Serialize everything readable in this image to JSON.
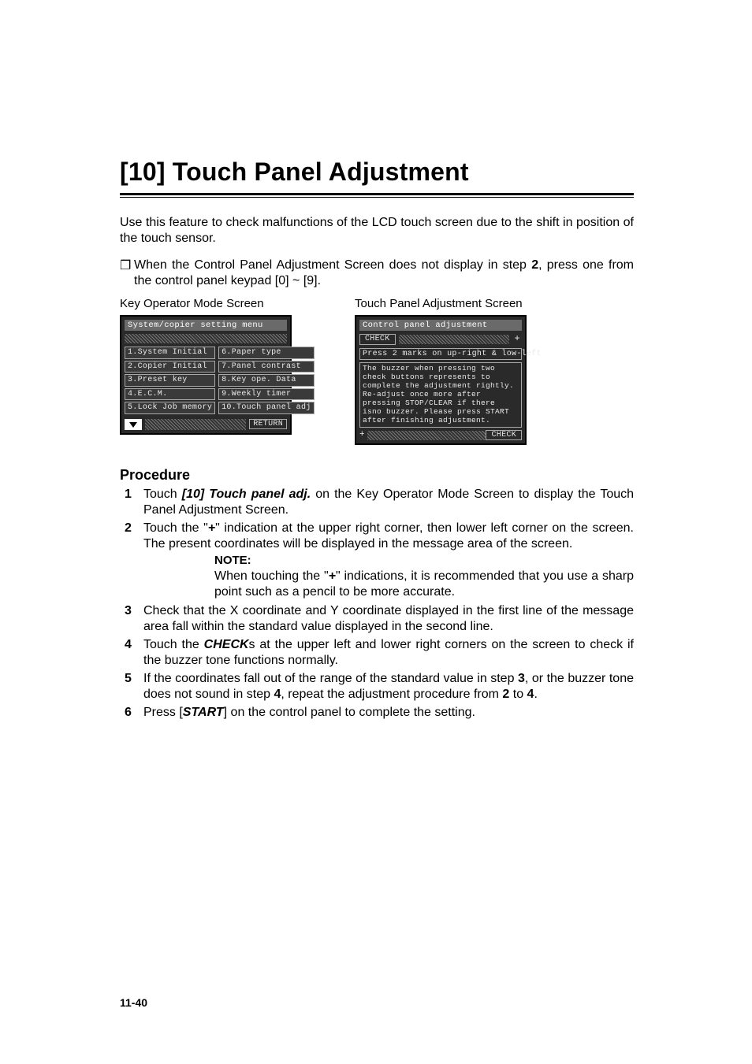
{
  "title": "[10] Touch Panel Adjustment",
  "intro": "Use this feature to check malfunctions of the LCD touch screen due to the shift in position of the touch sensor.",
  "bullet_symbol": "❐",
  "bullet_pre": "When the Control Panel Adjustment Screen does not display in step ",
  "bullet_bold": "2",
  "bullet_post": ", press one from the control panel keypad [0] ~ [9].",
  "screen1": {
    "caption": "Key Operator Mode Screen",
    "header": "System/copier setting menu",
    "left": [
      "1.System Initial",
      "2.Copier Initial",
      "3.Preset key",
      "4.E.C.M.",
      "5.Lock Job memory"
    ],
    "right": [
      "6.Paper type",
      "7.Panel contrast",
      "8.Key ope. Data",
      "9.Weekly timer",
      "10.Touch panel adj"
    ],
    "return": "RETURN"
  },
  "screen2": {
    "caption": "Touch Panel Adjustment Screen",
    "header": "Control panel adjustment",
    "check": "CHECK",
    "instr": "Press 2 marks on up-right & low-left",
    "body": "The buzzer when pressing two check buttons represents to complete the adjustment rightly. Re-adjust once more after pressing STOP/CLEAR if there isno buzzer. Please press START after finishing adjustment.",
    "plus": "+"
  },
  "procedure_h": "Procedure",
  "steps": {
    "s1_a": "Touch ",
    "s1_b": "[10] Touch panel adj.",
    "s1_c": " on the Key Operator Mode Screen to display the Touch Panel Adjustment Screen.",
    "s2_a": "Touch the \"",
    "s2_b": "+",
    "s2_c": "\" indication at the upper right corner, then lower left corner on the screen. The present coordinates will be displayed in the message area of the screen.",
    "note_label": "NOTE:",
    "note_a": "When touching the \"",
    "note_b": "+",
    "note_c": "\" indications, it is recommended that you use a sharp point such as a pencil to be more accurate.",
    "s3": "Check that the X coordinate and Y coordinate displayed in the first line of the message area fall within the standard value displayed in the second line.",
    "s4_a": "Touch the ",
    "s4_b": "CHECK",
    "s4_c": "s at the upper left and lower right corners on the screen to check if the buzzer tone functions normally.",
    "s5_a": "If the coordinates fall out of the range of the standard value in step ",
    "s5_b": "3",
    "s5_c": ", or the buzzer tone does not sound in step ",
    "s5_d": "4",
    "s5_e": ", repeat the adjustment procedure from ",
    "s5_f": "2",
    "s5_g": " to ",
    "s5_h": "4",
    "s5_i": ".",
    "s6_a": "Press [",
    "s6_b": "START",
    "s6_c": "] on the control panel to complete the setting."
  },
  "pagenum": "11-40"
}
